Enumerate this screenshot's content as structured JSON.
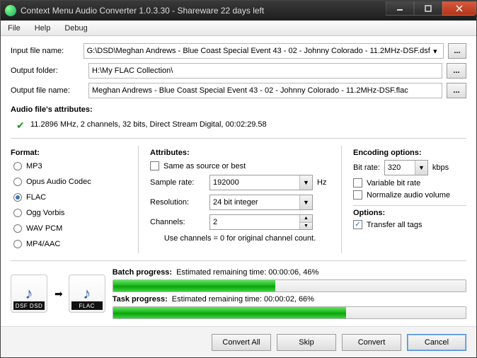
{
  "window": {
    "title": "Context Menu Audio Converter 1.0.3.30 - Shareware 22 days left"
  },
  "menubar": [
    "File",
    "Help",
    "Debug"
  ],
  "paths": {
    "input_label": "Input file name:",
    "input_value": "G:\\DSD\\Meghan Andrews - Blue Coast Special Event 43 - 02 - Johnny Colorado - 11.2MHz-DSF.dsf",
    "output_folder_label": "Output folder:",
    "output_folder_value": "H:\\My FLAC Collection\\",
    "output_file_label": "Output file name:",
    "output_file_value": "Meghan Andrews - Blue Coast Special Event 43 - 02 - Johnny Colorado - 11.2MHz-DSF.flac",
    "browse_label": "..."
  },
  "attributes": {
    "heading": "Audio file's attributes:",
    "value": "11.2896 MHz, 2 channels, 32 bits, Direct Stream Digital, 00:02:29.58"
  },
  "format": {
    "heading": "Format:",
    "options": [
      "MP3",
      "Opus Audio Codec",
      "FLAC",
      "Ogg Vorbis",
      "WAV PCM",
      "MP4/AAC"
    ],
    "selected": "FLAC"
  },
  "attr_panel": {
    "heading": "Attributes:",
    "same_as_source_label": "Same as source or best",
    "same_as_source_checked": false,
    "sample_rate_label": "Sample rate:",
    "sample_rate_value": "192000",
    "sample_rate_unit": "Hz",
    "resolution_label": "Resolution:",
    "resolution_value": "24 bit integer",
    "channels_label": "Channels:",
    "channels_value": "2",
    "hint": "Use channels = 0 for original channel count."
  },
  "encoding": {
    "heading": "Encoding options:",
    "bitrate_label": "Bit rate:",
    "bitrate_value": "320",
    "bitrate_unit": "kbps",
    "vbr_label": "Variable bit rate",
    "vbr_checked": false,
    "normalize_label": "Normalize audio volume",
    "normalize_checked": false,
    "options_heading": "Options:",
    "transfer_tags_label": "Transfer all tags",
    "transfer_tags_checked": true
  },
  "icons": {
    "from": "DSF DSD",
    "to": "FLAC"
  },
  "progress": {
    "batch_label": "Batch progress:",
    "batch_text": "Estimated remaining time: 00:00:06, 46%",
    "batch_percent": 46,
    "task_label": "Task progress:",
    "task_text": "Estimated remaining time: 00:00:02, 66%",
    "task_percent": 66
  },
  "buttons": {
    "convert_all": "Convert All",
    "skip": "Skip",
    "convert": "Convert",
    "cancel": "Cancel"
  }
}
